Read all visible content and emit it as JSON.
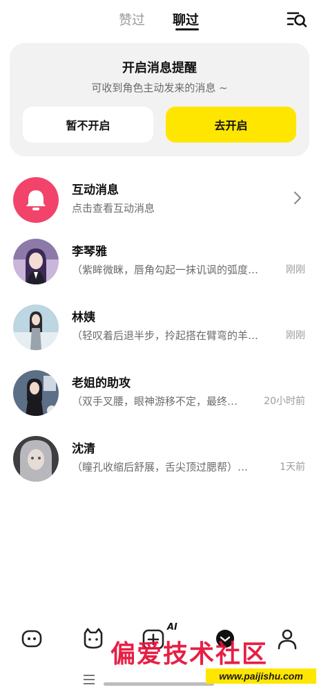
{
  "tabs": {
    "liked": "赞过",
    "chatted": "聊过"
  },
  "notice": {
    "title": "开启消息提醒",
    "subtitle": "可收到角色主动发来的消息 ~",
    "later_label": "暂不开启",
    "enable_label": "去开启"
  },
  "interaction": {
    "title": "互动消息",
    "subtitle": "点击查看互动消息"
  },
  "chats": [
    {
      "name": "李琴雅",
      "preview": "（紫眸微眯，唇角勾起一抹讥讽的弧度…",
      "time": "刚刚"
    },
    {
      "name": "林姨",
      "preview": "（轻叹着后退半步，拎起搭在臂弯的羊…",
      "time": "刚刚"
    },
    {
      "name": "老姐的助攻",
      "preview": "（双手叉腰，眼神游移不定，最终…",
      "time": "20小时前"
    },
    {
      "name": "沈清",
      "preview": "（瞳孔收缩后舒展，舌尖顶过腮帮）…",
      "time": "1天前"
    }
  ],
  "bottom_nav": {
    "ai_badge": "AI"
  },
  "watermark": {
    "text": "偏爱技术社区",
    "url": "www.paijishu.com"
  },
  "colors": {
    "accent": "#ffe600",
    "bell": "#f2446a",
    "watermark": "#e6143c"
  },
  "icons": [
    "search-list-icon",
    "bell-icon",
    "chevron-right-icon",
    "chat-bot-icon",
    "cat-icon",
    "create-ai-icon",
    "message-icon",
    "profile-icon"
  ]
}
